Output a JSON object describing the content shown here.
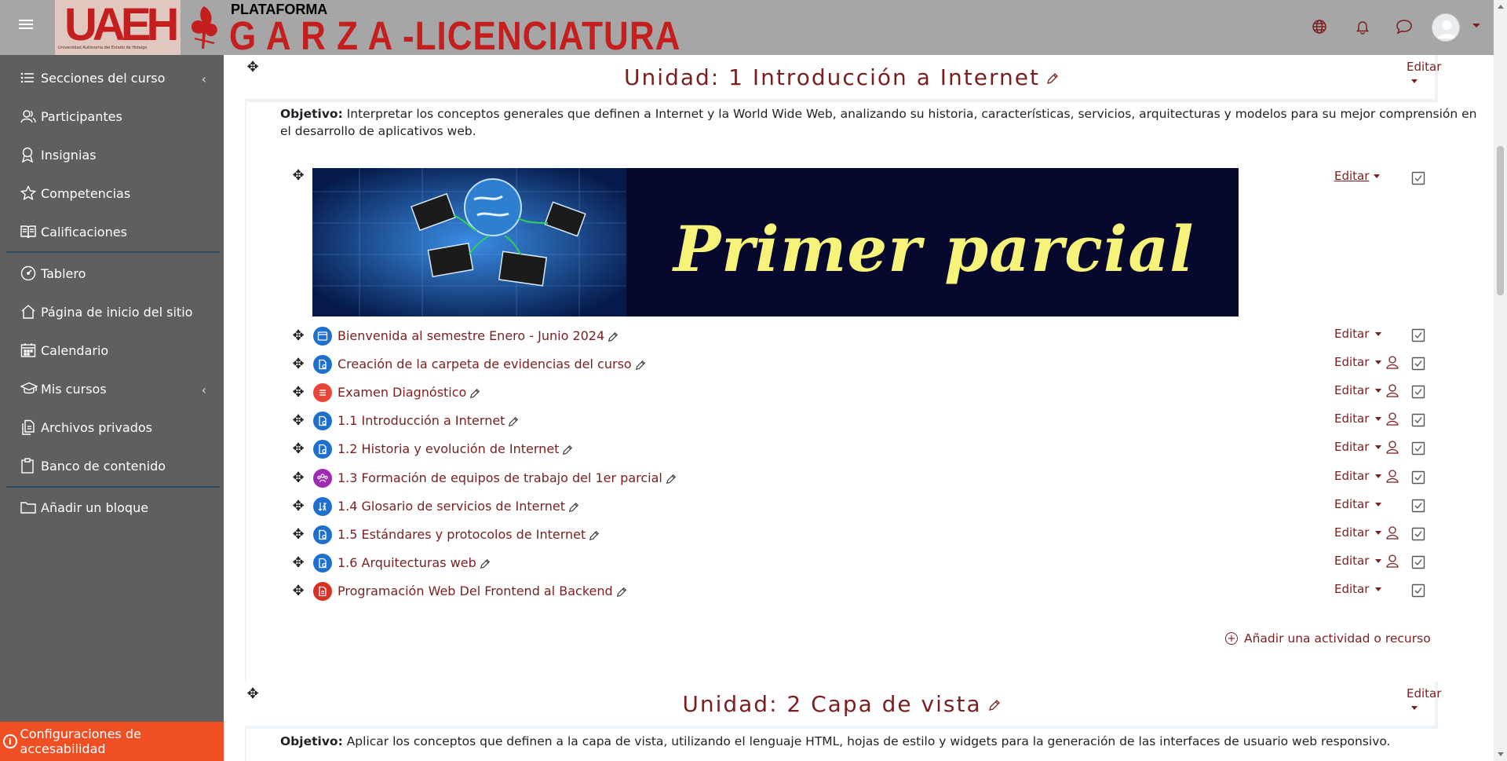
{
  "header": {
    "logo_text": "UAEH",
    "logo_subtext": "Universidad Autónoma del Estado de Hidalgo",
    "platform_label": "PLATAFORMA",
    "platform_name": "G A R Z A -LICENCIATURA"
  },
  "sidebar": {
    "items": [
      {
        "label": "Secciones del curso",
        "icon": "list-icon"
      },
      {
        "label": "Participantes",
        "icon": "users-icon"
      },
      {
        "label": "Insignias",
        "icon": "badge-icon"
      },
      {
        "label": "Competencias",
        "icon": "star-icon"
      },
      {
        "label": "Calificaciones",
        "icon": "book-icon"
      },
      {
        "label": "Tablero",
        "icon": "dashboard-icon"
      },
      {
        "label": "Página de inicio del sitio",
        "icon": "home-icon"
      },
      {
        "label": "Calendario",
        "icon": "calendar-icon"
      },
      {
        "label": "Mis cursos",
        "icon": "graduation-cap-icon"
      },
      {
        "label": "Archivos privados",
        "icon": "files-icon"
      },
      {
        "label": "Banco de contenido",
        "icon": "clipboard-icon"
      },
      {
        "label": "Añadir un bloque",
        "icon": "folder-icon"
      }
    ],
    "accessibility": "Configuraciones de accesabilidad"
  },
  "sections": [
    {
      "title": "Unidad: 1 Introducción a Internet",
      "edit_label": "Editar",
      "objective_label": "Objetivo:",
      "objective_text": " Interpretar los conceptos generales que definen a Internet y la World Wide Web, analizando su historia, características, servicios, arquitecturas y modelos para su mejor comprensión en el desarrollo de aplicativos web."
    },
    {
      "title": "Unidad: 2 Capa de vista",
      "edit_label": "Editar",
      "objective_label": "Objetivo:",
      "objective_text": " Aplicar los conceptos que definen a la capa de vista, utilizando el lenguaje HTML, hojas de estilo y widgets para la generación de las interfaces de usuario web responsivo."
    }
  ],
  "banner": {
    "text": "Primer parcial",
    "edit_label": "Editar"
  },
  "activities": [
    {
      "name": "Bienvenida al semestre Enero - Junio 2024",
      "edit": "Editar",
      "icon": "page-icon",
      "color": "#1f6fcf",
      "user_restricted": false
    },
    {
      "name": "Creación de la carpeta de evidencias del curso",
      "edit": "Editar",
      "icon": "assignment-icon",
      "color": "#1f6fcf",
      "user_restricted": true
    },
    {
      "name": "Examen Diagnóstico",
      "edit": "Editar",
      "icon": "quiz-icon",
      "color": "#e8443a",
      "user_restricted": true
    },
    {
      "name": "1.1 Introducción a Internet",
      "edit": "Editar",
      "icon": "assignment-icon",
      "color": "#1f6fcf",
      "user_restricted": true
    },
    {
      "name": "1.2 Historia y evolución de Internet",
      "edit": "Editar",
      "icon": "assignment-icon",
      "color": "#1f6fcf",
      "user_restricted": true
    },
    {
      "name": "1.3 Formación de equipos de trabajo del 1er parcial",
      "edit": "Editar",
      "icon": "groups-icon",
      "color": "#a12ab5",
      "user_restricted": true
    },
    {
      "name": "1.4 Glosario de servicios de Internet",
      "edit": "Editar",
      "icon": "glossary-icon",
      "color": "#1f6fcf",
      "user_restricted": false
    },
    {
      "name": "1.5 Estándares y protocolos de Internet",
      "edit": "Editar",
      "icon": "assignment-icon",
      "color": "#1f6fcf",
      "user_restricted": true
    },
    {
      "name": "1.6 Arquitecturas web",
      "edit": "Editar",
      "icon": "assignment-icon",
      "color": "#1f6fcf",
      "user_restricted": true
    },
    {
      "name": "Programación Web Del Frontend al Backend",
      "edit": "Editar",
      "icon": "pdf-icon",
      "color": "#d93025",
      "user_restricted": false
    }
  ],
  "add_activity": "Añadir una actividad o recurso",
  "colors": {
    "accent": "#7a1f1f",
    "navbar": "#a6a6a6",
    "sidebar": "#5f5f5f",
    "accessibility_bar": "#f04e23"
  }
}
